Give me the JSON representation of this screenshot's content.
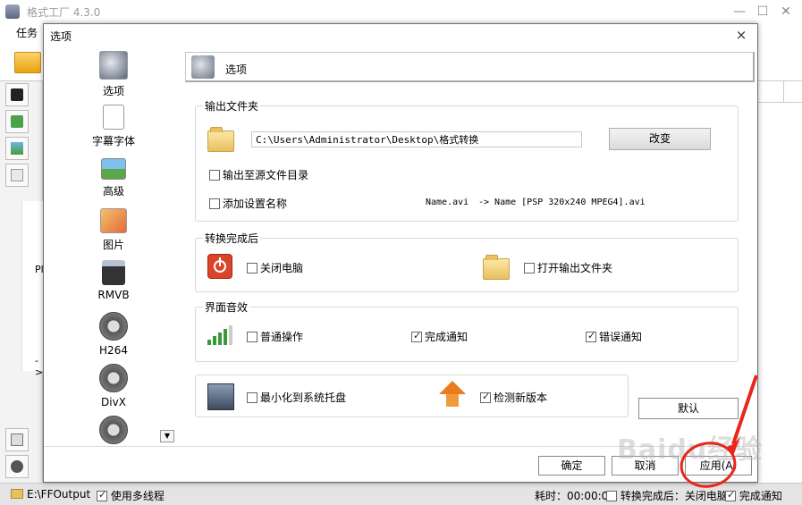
{
  "app": {
    "title": "格式工厂 4.3.0",
    "menu_task": "任务",
    "panel_text_1": "Pl",
    "panel_text_2": "->"
  },
  "window_controls": {
    "minimize": "—",
    "maximize": "☐",
    "close": "✕"
  },
  "status": {
    "output_path": "E:\\FFOutput",
    "multithread": "使用多线程",
    "elapsed": "耗时：00:00:00",
    "after_convert": "转换完成后：关闭电脑",
    "notify": "完成通知"
  },
  "dialog": {
    "title": "选项",
    "close": "×",
    "categories": [
      {
        "label": "选项",
        "icon": "options-icon"
      },
      {
        "label": "字幕字体",
        "icon": "subtitle-font-icon"
      },
      {
        "label": "高级",
        "icon": "advanced-icon"
      },
      {
        "label": "图片",
        "icon": "picture-icon"
      },
      {
        "label": "RMVB",
        "icon": "rmvb-icon"
      },
      {
        "label": "H264",
        "icon": "h264-film-icon"
      },
      {
        "label": "DivX",
        "icon": "divx-film-icon"
      }
    ],
    "scroll_arrow": "▼",
    "header_title": "选项",
    "output_folder": {
      "title": "输出文件夹",
      "path": "C:\\Users\\Administrator\\Desktop\\格式转换",
      "change_button": "改变",
      "to_source_dir": "输出至源文件目录",
      "add_setting_name": "添加设置名称",
      "example_from": "Name.avi",
      "example_to": "-> Name [PSP 320x240 MPEG4].avi"
    },
    "after_convert": {
      "title": "转换完成后",
      "shutdown": "关闭电脑",
      "open_folder": "打开输出文件夹"
    },
    "sound": {
      "title": "界面音效",
      "normal_op": "普通操作",
      "done_notify": "完成通知",
      "error_notify": "错误通知"
    },
    "tray": {
      "minimize_tray": "最小化到系统托盘",
      "check_update": "检测新版本"
    },
    "buttons": {
      "default": "默认",
      "ok": "确定",
      "cancel": "取消",
      "apply": "应用(A)"
    }
  },
  "watermark": "Baidu经验"
}
